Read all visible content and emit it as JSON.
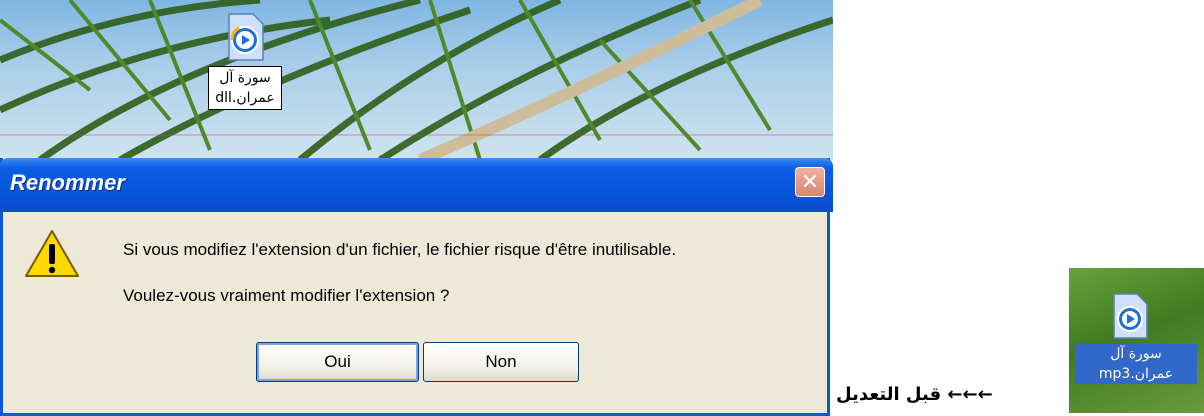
{
  "desktop": {
    "file_label": "سورة آل\nعمران.dll",
    "file_icon": "media-file-icon"
  },
  "dialog": {
    "title": "Renommer",
    "close_symbol": "✕",
    "message_line1": "Si vous modifiez l'extension d'un fichier, le fichier risque d'être inutilisable.",
    "message_line2": "Voulez-vous vraiment modifier l'extension ?",
    "yes_label": "Oui",
    "no_label": "Non",
    "warning_icon": "warning-icon"
  },
  "caption": {
    "text": "قبل التعديل ←←←"
  },
  "thumbnail": {
    "file_label": "سورة آل\nعمران.mp3",
    "file_icon": "media-file-icon"
  },
  "colors": {
    "titlebar": "#0855dc",
    "dialog_bg": "#ece9d8",
    "selection": "#3268c9"
  }
}
